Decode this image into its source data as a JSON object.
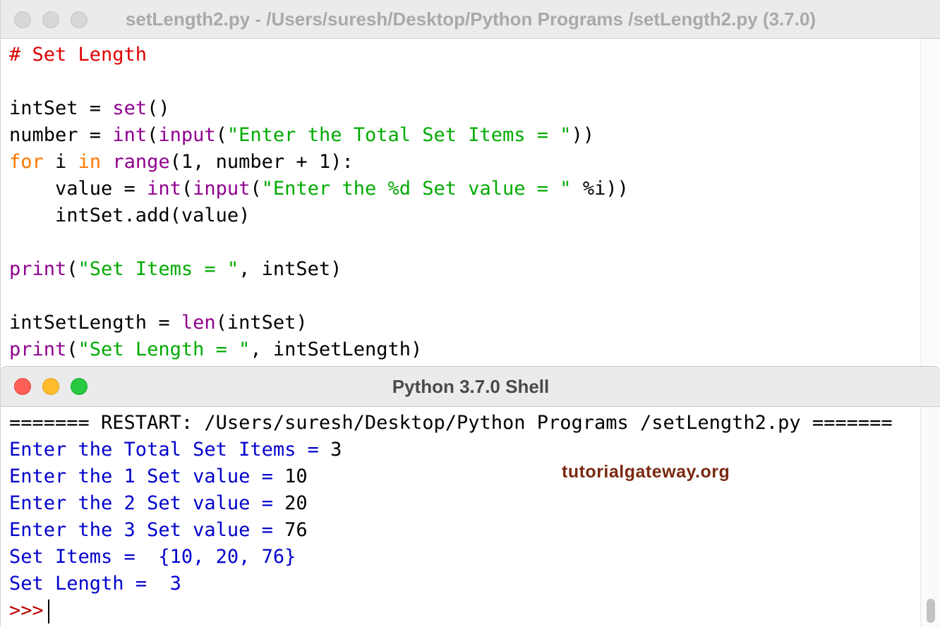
{
  "editor": {
    "title": "setLength2.py - /Users/suresh/Desktop/Python Programs /setLength2.py (3.7.0)",
    "code_lines": [
      [
        {
          "t": "# Set Length",
          "c": "cmt"
        }
      ],
      [],
      [
        {
          "t": "intSet = ",
          "c": ""
        },
        {
          "t": "set",
          "c": "bi"
        },
        {
          "t": "()",
          "c": ""
        }
      ],
      [
        {
          "t": "number = ",
          "c": ""
        },
        {
          "t": "int",
          "c": "bi"
        },
        {
          "t": "(",
          "c": ""
        },
        {
          "t": "input",
          "c": "bi"
        },
        {
          "t": "(",
          "c": ""
        },
        {
          "t": "\"Enter the Total Set Items = \"",
          "c": "str"
        },
        {
          "t": "))",
          "c": ""
        }
      ],
      [
        {
          "t": "for",
          "c": "kw"
        },
        {
          "t": " i ",
          "c": ""
        },
        {
          "t": "in",
          "c": "kw"
        },
        {
          "t": " ",
          "c": ""
        },
        {
          "t": "range",
          "c": "bi"
        },
        {
          "t": "(1, number + 1):",
          "c": ""
        }
      ],
      [
        {
          "t": "    value = ",
          "c": ""
        },
        {
          "t": "int",
          "c": "bi"
        },
        {
          "t": "(",
          "c": ""
        },
        {
          "t": "input",
          "c": "bi"
        },
        {
          "t": "(",
          "c": ""
        },
        {
          "t": "\"Enter the %d Set value = \"",
          "c": "str"
        },
        {
          "t": " %i))",
          "c": ""
        }
      ],
      [
        {
          "t": "    intSet.add(value)",
          "c": ""
        }
      ],
      [],
      [
        {
          "t": "print",
          "c": "bi"
        },
        {
          "t": "(",
          "c": ""
        },
        {
          "t": "\"Set Items = \"",
          "c": "str"
        },
        {
          "t": ", intSet)",
          "c": ""
        }
      ],
      [],
      [
        {
          "t": "intSetLength = ",
          "c": ""
        },
        {
          "t": "len",
          "c": "bi"
        },
        {
          "t": "(intSet)",
          "c": ""
        }
      ],
      [
        {
          "t": "print",
          "c": "bi"
        },
        {
          "t": "(",
          "c": ""
        },
        {
          "t": "\"Set Length = \"",
          "c": "str"
        },
        {
          "t": ", intSetLength)",
          "c": ""
        }
      ]
    ]
  },
  "shell": {
    "title": "Python 3.7.0 Shell",
    "lines": [
      [
        {
          "t": "======= RESTART: /Users/suresh/Desktop/Python Programs /setLength2.py =======",
          "c": ""
        }
      ],
      [
        {
          "t": "Enter the Total Set Items = ",
          "c": "out"
        },
        {
          "t": "3",
          "c": ""
        }
      ],
      [
        {
          "t": "Enter the 1 Set value = ",
          "c": "out"
        },
        {
          "t": "10",
          "c": ""
        }
      ],
      [
        {
          "t": "Enter the 2 Set value = ",
          "c": "out"
        },
        {
          "t": "20",
          "c": ""
        }
      ],
      [
        {
          "t": "Enter the 3 Set value = ",
          "c": "out"
        },
        {
          "t": "76",
          "c": ""
        }
      ],
      [
        {
          "t": "Set Items =  {10, 20, 76}",
          "c": "out"
        }
      ],
      [
        {
          "t": "Set Length =  3",
          "c": "out"
        }
      ]
    ],
    "prompt": ">>>",
    "watermark": "tutorialgateway.org"
  },
  "colors": {
    "comment": "#dd0000",
    "keyword": "#ff7700",
    "builtin": "#900090",
    "string": "#00aa00",
    "output": "#0000cc",
    "prompt": "#c00000",
    "watermark": "#7a2a10"
  },
  "icons": [
    "close-icon",
    "minimize-icon",
    "zoom-icon"
  ]
}
